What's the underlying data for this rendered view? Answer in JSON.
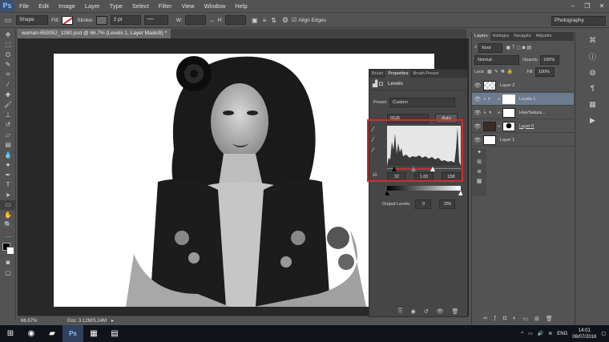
{
  "app": {
    "logo": "Ps"
  },
  "menu": [
    "File",
    "Edit",
    "Image",
    "Layer",
    "Type",
    "Select",
    "Filter",
    "View",
    "Window",
    "Help"
  ],
  "window_controls": [
    "–",
    "❐",
    "✕"
  ],
  "options_bar": {
    "shape_mode": "Shape",
    "fill_label": "Fill:",
    "stroke_label": "Stroke:",
    "stroke_size": "2 pt",
    "w_label": "W:",
    "h_label": "H:",
    "align_edges_label": "Align Edges",
    "workspace": "Photography"
  },
  "document": {
    "tab_title": "woman-659352_1280.psd @ 66.7% (Levels 1, Layer Mask/8) *",
    "zoom": "66.67%",
    "doc_size": "Doc: 3.12M/5.14M"
  },
  "properties_panel": {
    "tabs": [
      "Brush",
      "Properties",
      "Brush Preset"
    ],
    "active_tab": "Properties",
    "title": "Levels",
    "preset_label": "Preset:",
    "preset_value": "Custom",
    "channel": "RGB",
    "auto_label": "Auto",
    "input_black": "32",
    "input_gamma": "1.00",
    "input_white": "158",
    "output_label": "Output Levels:",
    "output_black": "0",
    "output_white": "255"
  },
  "layers_panel": {
    "tabs": [
      "Layers",
      "Histogra",
      "Navigato",
      "Adjustm"
    ],
    "active_tab": "Layers",
    "kind_label": "Kind",
    "blend_mode": "Normal",
    "opacity_label": "Opacity:",
    "opacity_value": "100%",
    "lock_label": "Lock:",
    "fill_label": "Fill:",
    "fill_value": "100%",
    "layers": [
      {
        "name": "Layer 2"
      },
      {
        "name": "Levels 1"
      },
      {
        "name": "Hue/Satura..."
      },
      {
        "name": "Layer 0"
      },
      {
        "name": "Layer 1"
      }
    ]
  },
  "taskbar": {
    "time": "14:01",
    "date": "06/07/2016",
    "language": "ENG"
  },
  "colors": {
    "highlight": "#d22b2b",
    "panel": "#535353",
    "canvas_bg": "#282828"
  }
}
